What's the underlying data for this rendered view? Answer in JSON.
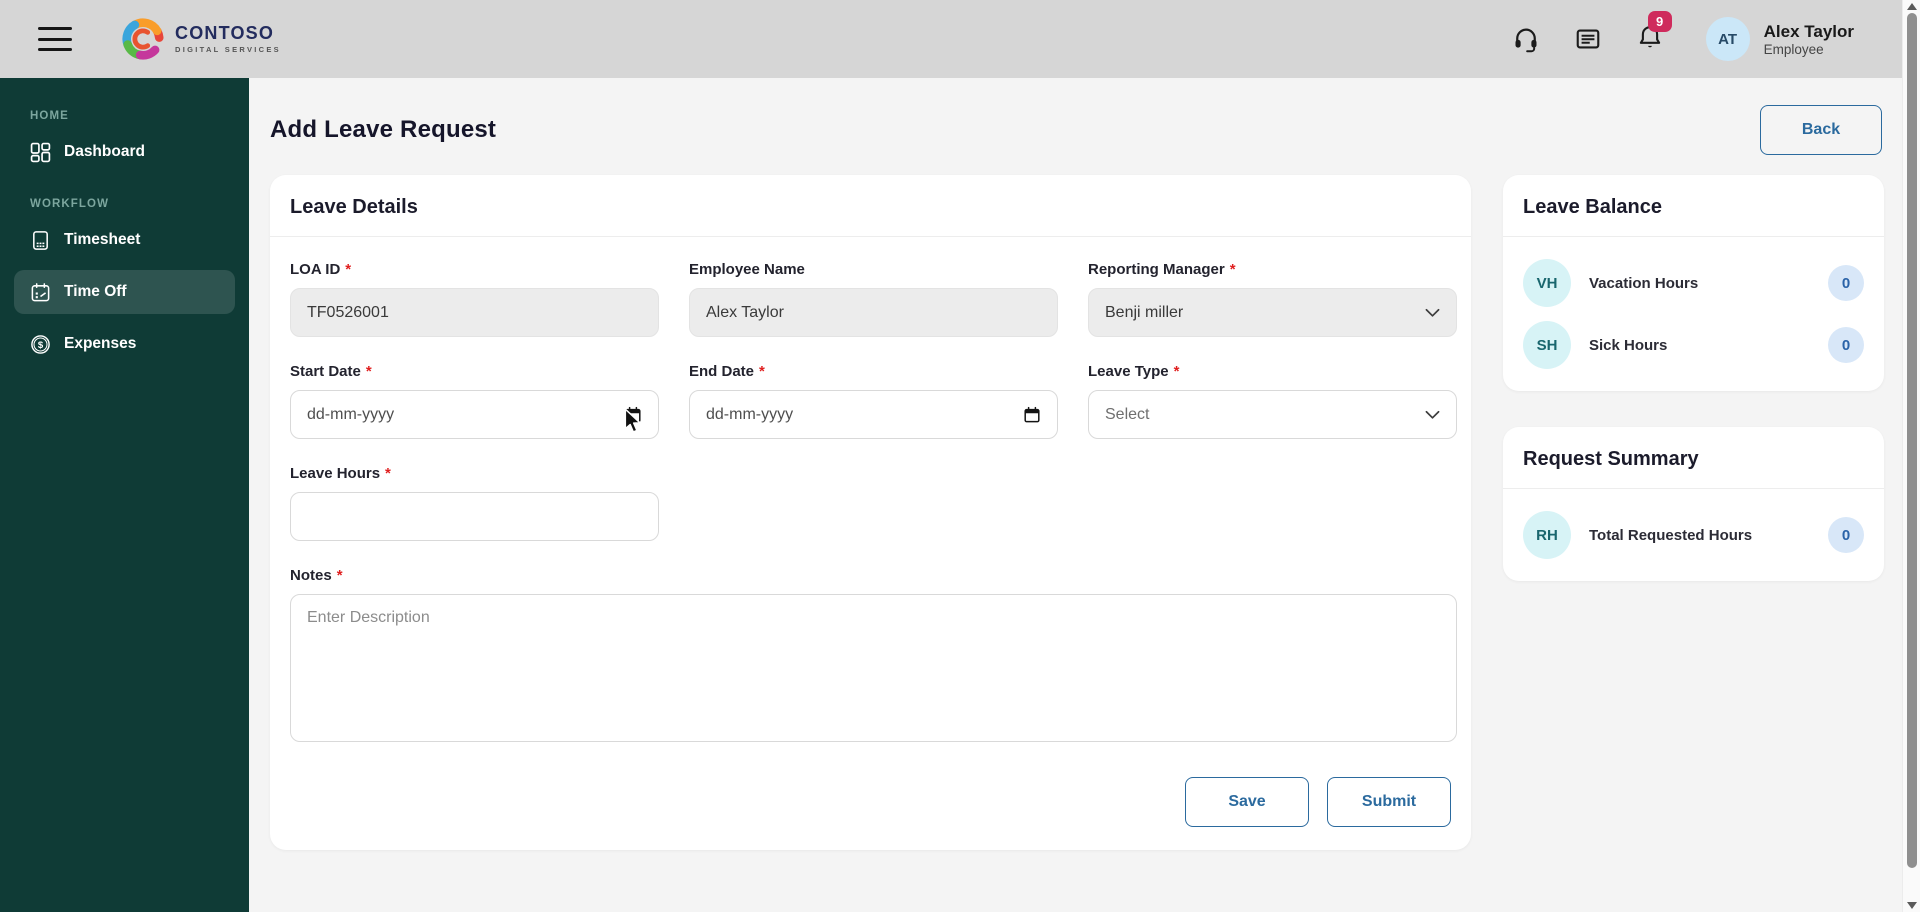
{
  "ui": {
    "required_marker": "*"
  },
  "header": {
    "brand": {
      "name": "CONTOSO",
      "tagline": "DIGITAL SERVICES"
    },
    "notifications_count": "9",
    "user": {
      "initials": "AT",
      "name": "Alex Taylor",
      "role": "Employee"
    }
  },
  "sidebar": {
    "sections": [
      {
        "label": "HOME",
        "items": [
          {
            "label": "Dashboard",
            "icon": "dashboard-grid-icon",
            "active": false
          }
        ]
      },
      {
        "label": "WORKFLOW",
        "items": [
          {
            "label": "Timesheet",
            "icon": "timesheet-document-icon",
            "active": false
          },
          {
            "label": "Time Off",
            "icon": "time-off-calendar-icon",
            "active": true
          },
          {
            "label": "Expenses",
            "icon": "expenses-dollar-icon",
            "active": false
          }
        ]
      }
    ]
  },
  "page": {
    "title": "Add Leave Request",
    "back_label": "Back"
  },
  "form": {
    "title": "Leave Details",
    "fields": {
      "loa_id": {
        "label": "LOA ID",
        "required": true,
        "value": "TF0526001",
        "disabled": true
      },
      "employee_name": {
        "label": "Employee Name",
        "required": false,
        "value": "Alex Taylor",
        "disabled": true
      },
      "reporting_manager": {
        "label": "Reporting Manager",
        "required": true,
        "value": "Benji miller",
        "disabled": true
      },
      "start_date": {
        "label": "Start Date",
        "required": true,
        "placeholder": "dd-mm-yyyy"
      },
      "end_date": {
        "label": "End Date",
        "required": true,
        "placeholder": "dd-mm-yyyy"
      },
      "leave_type": {
        "label": "Leave Type",
        "required": true,
        "value": "Select"
      },
      "leave_hours": {
        "label": "Leave Hours",
        "required": true,
        "value": ""
      },
      "notes": {
        "label": "Notes",
        "required": true,
        "placeholder": "Enter Description"
      }
    },
    "actions": {
      "save": "Save",
      "submit": "Submit"
    }
  },
  "leave_balance": {
    "title": "Leave Balance",
    "rows": [
      {
        "initials": "VH",
        "label": "Vacation Hours",
        "value": "0"
      },
      {
        "initials": "SH",
        "label": "Sick Hours",
        "value": "0"
      }
    ]
  },
  "request_summary": {
    "title": "Request Summary",
    "rows": [
      {
        "initials": "RH",
        "label": "Total Requested Hours",
        "value": "0"
      }
    ]
  },
  "colors": {
    "accent_blue": "#2b6a9e",
    "sidebar_bg": "#0f3b36",
    "header_bg": "#d6d6d6",
    "page_bg": "#f4f4f4",
    "notification_badge": "#cf2b5c",
    "avatar_bg": "#cbe7f8",
    "stat_avatar_bg": "#d7f3f6",
    "stat_badge_bg": "#d8e7f8",
    "required_red": "#e01f1f"
  }
}
